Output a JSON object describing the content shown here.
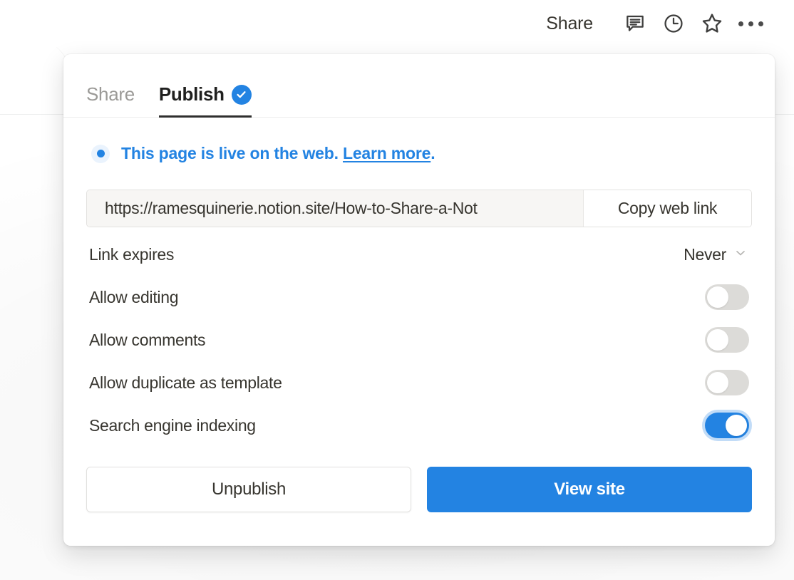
{
  "topbar": {
    "share_label": "Share",
    "icons": [
      {
        "name": "comment-icon"
      },
      {
        "name": "clock-history-icon"
      },
      {
        "name": "star-favorite-icon"
      },
      {
        "name": "more-options-icon"
      }
    ]
  },
  "modal": {
    "tabs": [
      {
        "label": "Share",
        "active": false,
        "badge": false
      },
      {
        "label": "Publish",
        "active": true,
        "badge": true
      }
    ],
    "status": {
      "text_before": "This page is live on the web.",
      "link_label": "Learn more",
      "text_after": "."
    },
    "url": {
      "value": "https://ramesquinerie.notion.site/How-to-Share-a-Not",
      "placeholder": "https://",
      "copy_label": "Copy web link"
    },
    "settings": [
      {
        "label": "Link expires",
        "control": "select",
        "value": "Never"
      },
      {
        "label": "Allow editing",
        "control": "toggle",
        "on": false
      },
      {
        "label": "Allow comments",
        "control": "toggle",
        "on": false
      },
      {
        "label": "Allow duplicate as template",
        "control": "toggle",
        "on": false
      },
      {
        "label": "Search engine indexing",
        "control": "toggle",
        "on": true
      }
    ],
    "footer": {
      "secondary_label": "Unpublish",
      "primary_label": "View site"
    }
  },
  "colors": {
    "accent_blue": "#2383e2",
    "text_default": "#37352f",
    "text_muted": "#9b9a97",
    "toggle_off": "#dcdbd8",
    "field_bg": "#f7f6f4"
  }
}
